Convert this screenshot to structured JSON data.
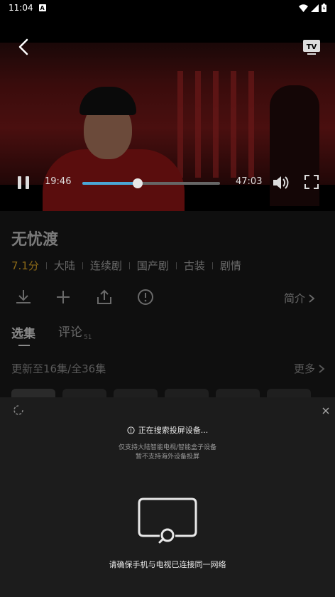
{
  "status_bar": {
    "time": "11:04",
    "icons": [
      "notification-a-icon",
      "wifi-icon",
      "signal-icon",
      "battery-icon"
    ]
  },
  "player": {
    "current_time": "19:46",
    "total_time": "47:03",
    "progress": 0.4,
    "icons": [
      "back-icon",
      "tv-cast-icon",
      "pause-icon",
      "volume-icon",
      "fullscreen-icon"
    ],
    "accent_color": "#4aa6d6"
  },
  "show": {
    "title": "无忧渡",
    "score": "7.1分",
    "tags": [
      "大陆",
      "连续剧",
      "国产剧",
      "古装",
      "剧情"
    ],
    "score_color": "#8c6a18"
  },
  "actions": {
    "icons": [
      "download-icon",
      "add-icon",
      "share-icon",
      "report-icon"
    ],
    "intro_label": "简介"
  },
  "tabs": {
    "episodes": "选集",
    "comments": "评论",
    "comments_count": "51"
  },
  "episodes": {
    "update_text": "更新至16集/全36集",
    "more_label": "更多"
  },
  "cast_sheet": {
    "searching_text": "正在搜索投屏设备...",
    "note_line1": "仅支持大陆智能电视/智能盒子设备",
    "note_line2": "暂不支持海外设备投屏",
    "network_msg": "请确保手机与电视已连接同一网络"
  }
}
